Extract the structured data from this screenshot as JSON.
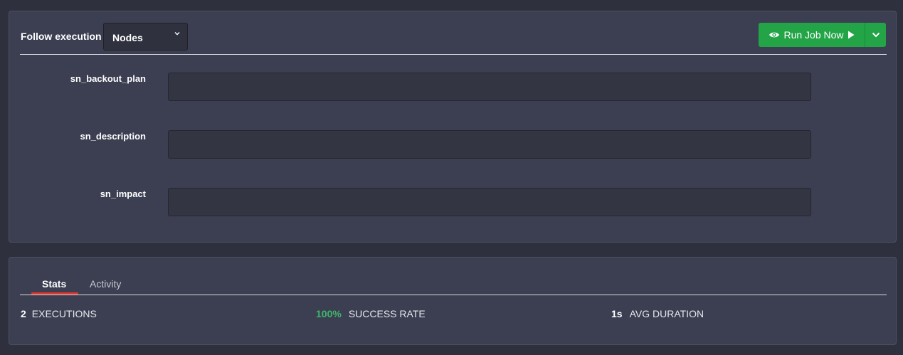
{
  "follow": {
    "label": "Follow execution",
    "selected": "Nodes"
  },
  "run_button": {
    "label": "Run Job Now",
    "color": "#22a447"
  },
  "options": [
    {
      "name": "sn_backout_plan",
      "value": ""
    },
    {
      "name": "sn_description",
      "value": ""
    },
    {
      "name": "sn_impact",
      "value": ""
    }
  ],
  "tabs": [
    {
      "label": "Stats",
      "active": true
    },
    {
      "label": "Activity",
      "active": false
    }
  ],
  "stats": {
    "executions": {
      "value": "2",
      "label": "EXECUTIONS"
    },
    "success_rate": {
      "value": "100%",
      "label": "SUCCESS RATE",
      "color": "#3db76a"
    },
    "avg_duration": {
      "value": "1s",
      "label": "AVG DURATION"
    }
  },
  "icons": {
    "select_caret": "chevron-down-icon",
    "run_eye": "eye-icon",
    "run_play": "play-icon",
    "run_menu": "chevron-down-icon"
  },
  "colors": {
    "background": "#2e303d",
    "panel": "#3c3f52",
    "tab_active_underline": "#e2372f"
  }
}
